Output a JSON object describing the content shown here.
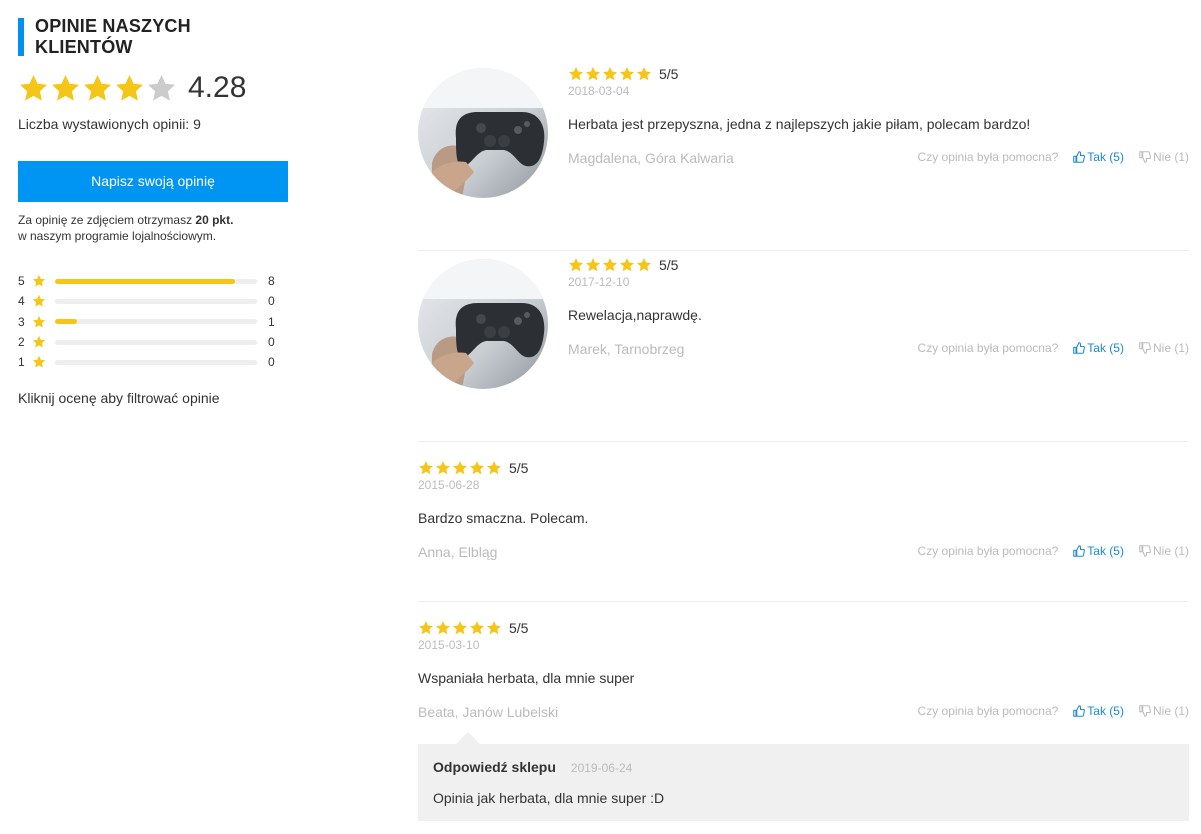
{
  "header": {
    "title": "OPINIE NASZYCH KLIENTÓW"
  },
  "summary": {
    "average": "4.28",
    "average_value": 4.28,
    "max_rating": 5,
    "count_text": "Liczba wystawionych opinii: 9",
    "write_button": "Napisz swoją opinię",
    "promo_line1_prefix": "Za opinię ze zdjęciem otrzymasz ",
    "promo_points": "20 pkt.",
    "promo_line2": "w naszym programie lojalnościowym.",
    "filter_hint": "Kliknij ocenę aby filtrować opinie"
  },
  "distribution": [
    {
      "rating": "5",
      "count": "8",
      "fraction": 0.889
    },
    {
      "rating": "4",
      "count": "0",
      "fraction": 0
    },
    {
      "rating": "3",
      "count": "1",
      "fraction": 0.111
    },
    {
      "rating": "2",
      "count": "0",
      "fraction": 0
    },
    {
      "rating": "1",
      "count": "0",
      "fraction": 0
    }
  ],
  "helpful": {
    "question": "Czy opinia była pomocna?",
    "yes_label": "Tak (5)",
    "no_label": "Nie (1)"
  },
  "reviews": [
    {
      "stars": 5,
      "score": "5/5",
      "date": "2018-03-04",
      "text": "Herbata jest przepyszna, jedna z najlepszych jakie piłam, polecam bardzo!",
      "author": "Magdalena, Góra Kalwaria",
      "has_photo": true
    },
    {
      "stars": 5,
      "score": "5/5",
      "date": "2017-12-10",
      "text": "Rewelacja,naprawdę.",
      "author": "Marek, Tarnobrzeg",
      "has_photo": true
    },
    {
      "stars": 5,
      "score": "5/5",
      "date": "2015-06-28",
      "text": "Bardzo smaczna. Polecam.",
      "author": "Anna, Elbląg",
      "has_photo": false
    },
    {
      "stars": 5,
      "score": "5/5",
      "date": "2015-03-10",
      "text": "Wspaniała herbata, dla mnie super",
      "author": "Beata, Janów Lubelski",
      "has_photo": false
    }
  ],
  "reply": {
    "title": "Odpowiedź sklepu",
    "date": "2019-06-24",
    "text": "Opinia jak herbata, dla mnie super :D"
  },
  "colors": {
    "accent": "#0095f2",
    "star": "#f5c518",
    "star_empty": "#cccccc",
    "link": "#1a8ad4",
    "muted": "#bbbbbb"
  },
  "icons": [
    "star-icon",
    "thumbs-up-icon",
    "thumbs-down-icon"
  ]
}
